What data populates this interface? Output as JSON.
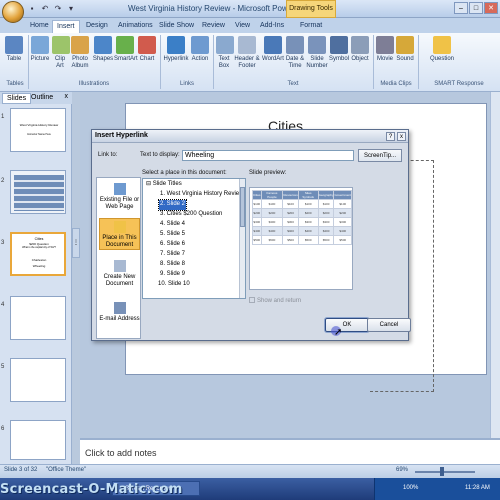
{
  "window": {
    "title": "West Virginia History Review - Microsoft PowerPoint",
    "contextual_tab": "Drawing Tools",
    "buttons": [
      "–",
      "□",
      "✕"
    ]
  },
  "tabs": [
    "Home",
    "Insert",
    "Design",
    "Animations",
    "Slide Show",
    "Review",
    "View",
    "Add-Ins",
    "Format"
  ],
  "active_tab": "Insert",
  "ribbon": {
    "buttons": [
      {
        "label": "Table",
        "color": "#5b86c2"
      },
      {
        "label": "Picture",
        "color": "#7aa7d8"
      },
      {
        "label": "Clip Art",
        "color": "#9cc46a"
      },
      {
        "label": "Photo Album",
        "color": "#d9a34a"
      },
      {
        "label": "Shapes",
        "color": "#4c86c9"
      },
      {
        "label": "SmartArt",
        "color": "#68b04b"
      },
      {
        "label": "Chart",
        "color": "#d15b4d"
      },
      {
        "label": "Hyperlink",
        "color": "#3b7fc7"
      },
      {
        "label": "Action",
        "color": "#6e9ad0"
      },
      {
        "label": "Text Box",
        "color": "#8aa9cf"
      },
      {
        "label": "Header & Footer",
        "color": "#a8b9d2"
      },
      {
        "label": "WordArt",
        "color": "#4a79b8"
      },
      {
        "label": "Date & Time",
        "color": "#7891b8"
      },
      {
        "label": "Slide Number",
        "color": "#7a93bb"
      },
      {
        "label": "Symbol",
        "color": "#4f6f9f"
      },
      {
        "label": "Object",
        "color": "#8b9db8"
      },
      {
        "label": "Movie",
        "color": "#7e7e96"
      },
      {
        "label": "Sound",
        "color": "#d6a839"
      },
      {
        "label": "Question",
        "color": "#f0c247"
      }
    ],
    "groups": [
      "Tables",
      "Illustrations",
      "Links",
      "Text",
      "Media Clips",
      "SMART Response"
    ]
  },
  "left_pane": {
    "tabs": [
      "Slides",
      "Outline"
    ],
    "close": "x",
    "thumbnails": [
      {
        "num": "1",
        "lines": [
          "West Virginia History Review",
          "Instructor Name Here"
        ]
      },
      {
        "num": "2",
        "lines": []
      },
      {
        "num": "3",
        "lines": [
          "Cities",
          "$200 Question",
          "What is the capital city of WV?",
          "Charleston",
          "Wheeling"
        ]
      },
      {
        "num": "4",
        "lines": []
      },
      {
        "num": "5",
        "lines": []
      },
      {
        "num": "6",
        "lines": []
      }
    ]
  },
  "slide": {
    "title": "Cities"
  },
  "notes_placeholder": "Click to add notes",
  "status": {
    "slide_info": "Slide 3 of 32",
    "theme": "\"Office Theme\"",
    "zoom": "69%"
  },
  "taskbar": {
    "watermark": "Screencast-O-Matic.com",
    "app": "Screen Recorder",
    "battery": "100%",
    "time": "11:28 AM"
  },
  "dialog": {
    "title": "Insert Hyperlink",
    "help": "?",
    "close": "x",
    "link_to_label": "Link to:",
    "text_to_display_label": "Text to display:",
    "text_to_display_value": "Wheeling",
    "screentip_button": "ScreenTip...",
    "select_place_label": "Select a place in this document:",
    "slide_preview_label": "Slide preview:",
    "link_options": [
      {
        "label": "Existing File or Web Page",
        "icon": "web-page-icon",
        "active": false
      },
      {
        "label": "Place in This Document",
        "icon": "document-place-icon",
        "active": true
      },
      {
        "label": "Create New Document",
        "icon": "new-document-icon",
        "active": false
      },
      {
        "label": "E-mail Address",
        "icon": "email-icon",
        "active": false
      }
    ],
    "tree": {
      "root": "Slide Titles",
      "items": [
        "1. West Virginia History Review",
        "2. Slide 2",
        "3. Cities  $200 Question",
        "4. Slide 4",
        "5. Slide 5",
        "6. Slide 6",
        "7. Slide 7",
        "8. Slide 8",
        "9. Slide 9",
        "10. Slide 10"
      ],
      "selected_index": 1
    },
    "preview_headers": [
      "Cities",
      "Famous People",
      "Resources",
      "Sites Symbols",
      "Geography",
      "Government"
    ],
    "preview_values": [
      "$100",
      "$200",
      "$300",
      "$400",
      "$500"
    ],
    "show_and_return": "Show and return",
    "ok_label": "OK",
    "cancel_label": "Cancel"
  }
}
